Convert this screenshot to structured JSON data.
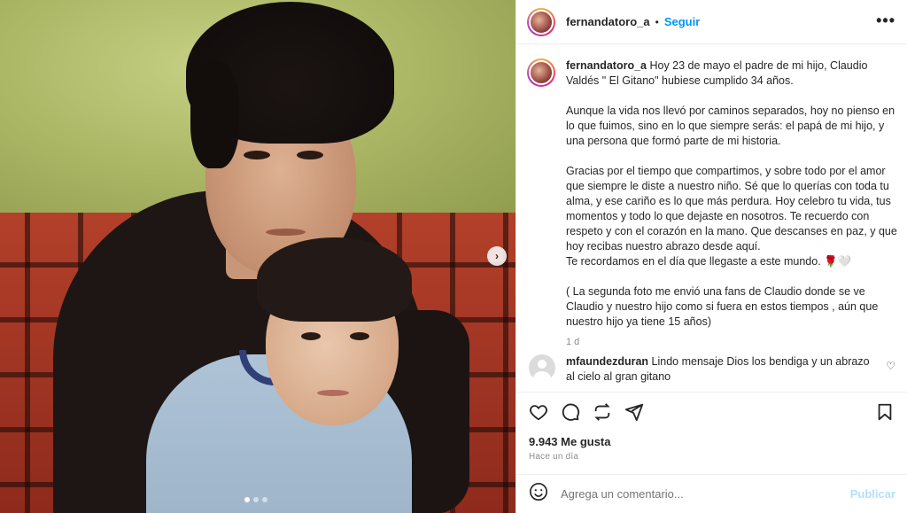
{
  "post": {
    "username": "fernandatoro_a",
    "separator": "•",
    "follow_label": "Seguir",
    "more_icon": "more-horizontal-icon"
  },
  "caption": {
    "username": "fernandatoro_a",
    "p1": " Hoy 23 de mayo el padre de mi hijo, Claudio Valdés \" El Gitano\" hubiese cumplido 34 años.",
    "p2": "Aunque la vida nos llevó por caminos separados, hoy no pienso en lo que fuimos, sino en lo que siempre serás: el papá de mi hijo, y una persona que formó parte de mi historia.",
    "p3": "Gracias por el tiempo que compartimos, y sobre todo por el amor que siempre le diste a nuestro niño. Sé que lo querías con toda tu alma, y ese cariño es lo que más perdura. Hoy celebro tu vida, tus momentos y todo lo que dejaste en nosotros. Te recuerdo con respeto y con el corazón en la mano. Que descanses en paz, y que hoy recibas nuestro abrazo desde aquí.",
    "p4": "Te recordamos en el día que llegaste a este mundo. 🌹🤍",
    "p5": "( La segunda foto me envió una fans de Claudio donde se ve Claudio y nuestro hijo como si fuera en estos tiempos , aún que nuestro hijo ya tiene 15 años)",
    "time": "1 d"
  },
  "comment": {
    "username": "mfaundezduran",
    "text": " Lindo mensaje Dios los bendiga y un abrazo al cielo al gran gitano"
  },
  "actions": {
    "likes": "9.943 Me gusta",
    "ago": "Hace un día"
  },
  "add_comment": {
    "placeholder": "Agrega un comentario...",
    "post_label": "Publicar"
  },
  "carousel": {
    "next_label": "›",
    "slides": 3,
    "active_slide": 1
  }
}
